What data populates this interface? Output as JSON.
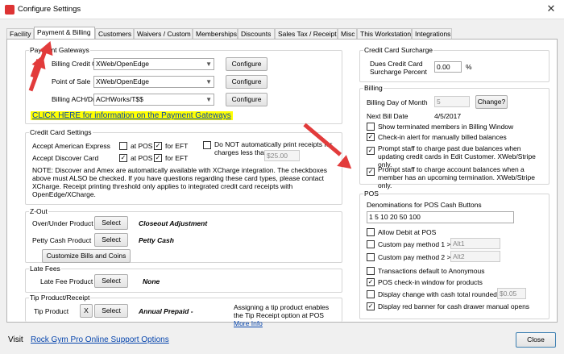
{
  "window": {
    "title": "Configure Settings",
    "close_glyph": "✕"
  },
  "tabs": [
    "Facility",
    "Payment & Billing",
    "Customers",
    "Waivers / Custom",
    "Memberships",
    "Discounts",
    "Sales Tax / Receipt",
    "Misc",
    "This Workstation",
    "Integrations"
  ],
  "payment_gateways": {
    "title": "Payment Gateways",
    "rows": [
      {
        "label": "Billing Credit Card",
        "value": "XWeb/OpenEdge",
        "button": "Configure"
      },
      {
        "label": "Point of Sale",
        "value": "XWeb/OpenEdge",
        "button": "Configure"
      },
      {
        "label": "Billing ACH/Draft",
        "value": "ACHWorks/T$$",
        "button": "Configure"
      }
    ],
    "info_link": "CLICK HERE for information on the Payment Gateways"
  },
  "cc_settings": {
    "title": "Credit Card Settings",
    "amex_label": "Accept American Express",
    "discover_label": "Accept Discover Card",
    "at_pos": "at POS",
    "for_eft": "for EFT",
    "no_print_label": "Do NOT automatically print receipts for charges less than",
    "threshold": "$25.00",
    "note": "NOTE:  Discover and Amex are automatically available with XCharge integration.  The checkboxes above must ALSO be checked.  If you have questions regarding these card types, please contact XCharge.  Receipt printing threshold only applies to integrated credit card receipts with OpenEdge/XCharge."
  },
  "zout": {
    "title": "Z-Out",
    "overunder_label": "Over/Under Product",
    "overunder_value": "Closeout Adjustment",
    "petty_label": "Petty Cash Product",
    "petty_value": "Petty Cash",
    "select": "Select",
    "customize": "Customize Bills and Coins"
  },
  "late_fees": {
    "title": "Late Fees",
    "label": "Late Fee Product",
    "select": "Select",
    "value": "None"
  },
  "tip": {
    "title": "Tip Product/Receipt",
    "label": "Tip Product",
    "x_button": "X",
    "select": "Select",
    "value": "Annual Prepaid -",
    "note": "Assigning a tip product enables the Tip Receipt option at POS",
    "more_info": "More Info"
  },
  "surcharge": {
    "title": "Credit Card Surcharge",
    "label_line1": "Dues Credit Card",
    "label_line2": "Surcharge Percent",
    "value": "0.00",
    "unit": "%"
  },
  "billing": {
    "title": "Billing",
    "day_label": "Billing Day of Month",
    "day_value": "5",
    "change_button": "Change?",
    "next_bill_label": "Next Bill Date",
    "next_bill_value": "4/5/2017",
    "opt_terminated": "Show terminated members in Billing Window",
    "opt_checkin_alert": "Check-in alert for manually billed balances",
    "opt_past_due": "Prompt staff to charge past due balances when updating credit cards in Edit Customer.  XWeb/Stripe only.",
    "opt_termination": "Prompt staff to charge account balances when a member has an upcoming termination.  XWeb/Stripe only."
  },
  "pos": {
    "title": "POS",
    "denoms_label": "Denominations for POS Cash Buttons",
    "denoms_value": "1 5 10 20 50 100",
    "allow_debit": "Allow Debit at POS",
    "custom1_label": "Custom pay method 1 >",
    "custom1_value": "Alt1",
    "custom2_label": "Custom pay method 2 >",
    "custom2_value": "Alt2",
    "anon": "Transactions default to Anonymous",
    "checkin_window": "POS check-in window for products",
    "display_change": "Display change with cash total rounded to",
    "round_value": "$0.05",
    "red_banner": "Display red banner for cash drawer manual opens"
  },
  "footer": {
    "visit_label": "Visit",
    "support_link": "Rock Gym Pro Online Support Options",
    "close_button": "Close"
  },
  "colors": {
    "link": "#0645ad",
    "highlight": "#ffff00",
    "arrow": "#e23b3b"
  }
}
